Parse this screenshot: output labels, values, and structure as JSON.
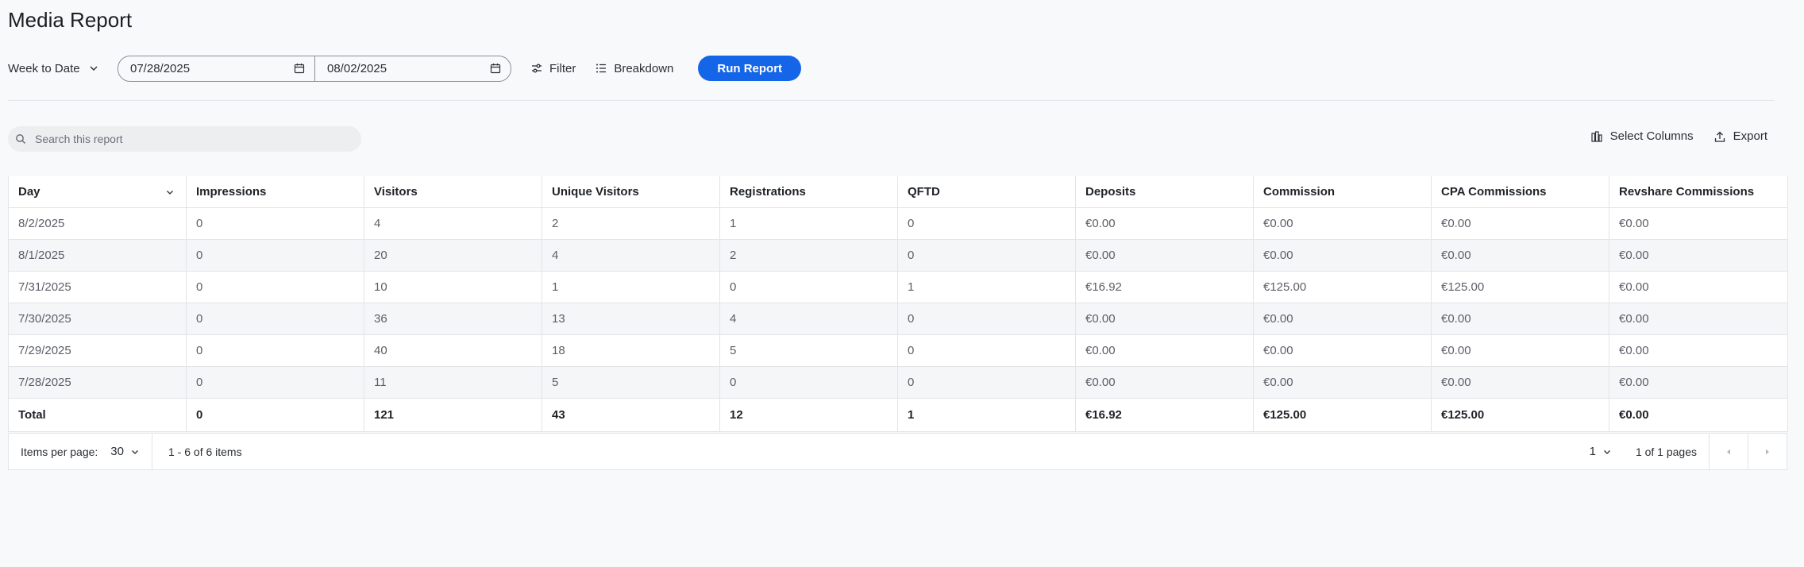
{
  "page": {
    "title": "Media Report"
  },
  "toolbar": {
    "period": "Week to Date",
    "date_from": "07/28/2025",
    "date_to": "08/02/2025",
    "filter_label": "Filter",
    "breakdown_label": "Breakdown",
    "run_label": "Run Report",
    "accent_color": "#1565e8"
  },
  "search": {
    "placeholder": "Search this report"
  },
  "actions": {
    "select_columns_label": "Select Columns",
    "export_label": "Export"
  },
  "table": {
    "columns": [
      "Day",
      "Impressions",
      "Visitors",
      "Unique Visitors",
      "Registrations",
      "QFTD",
      "Deposits",
      "Commission",
      "CPA Commissions",
      "Revshare Commissions"
    ],
    "rows": [
      [
        "8/2/2025",
        "0",
        "4",
        "2",
        "1",
        "0",
        "€0.00",
        "€0.00",
        "€0.00",
        "€0.00"
      ],
      [
        "8/1/2025",
        "0",
        "20",
        "4",
        "2",
        "0",
        "€0.00",
        "€0.00",
        "€0.00",
        "€0.00"
      ],
      [
        "7/31/2025",
        "0",
        "10",
        "1",
        "0",
        "1",
        "€16.92",
        "€125.00",
        "€125.00",
        "€0.00"
      ],
      [
        "7/30/2025",
        "0",
        "36",
        "13",
        "4",
        "0",
        "€0.00",
        "€0.00",
        "€0.00",
        "€0.00"
      ],
      [
        "7/29/2025",
        "0",
        "40",
        "18",
        "5",
        "0",
        "€0.00",
        "€0.00",
        "€0.00",
        "€0.00"
      ],
      [
        "7/28/2025",
        "0",
        "11",
        "5",
        "0",
        "0",
        "€0.00",
        "€0.00",
        "€0.00",
        "€0.00"
      ]
    ],
    "total": [
      "Total",
      "0",
      "121",
      "43",
      "12",
      "1",
      "€16.92",
      "€125.00",
      "€125.00",
      "€0.00"
    ]
  },
  "pager": {
    "items_per_page_label": "Items per page:",
    "items_per_page": "30",
    "range": "1 - 6 of 6 items",
    "page": "1",
    "pages_of": "1 of 1 pages"
  }
}
